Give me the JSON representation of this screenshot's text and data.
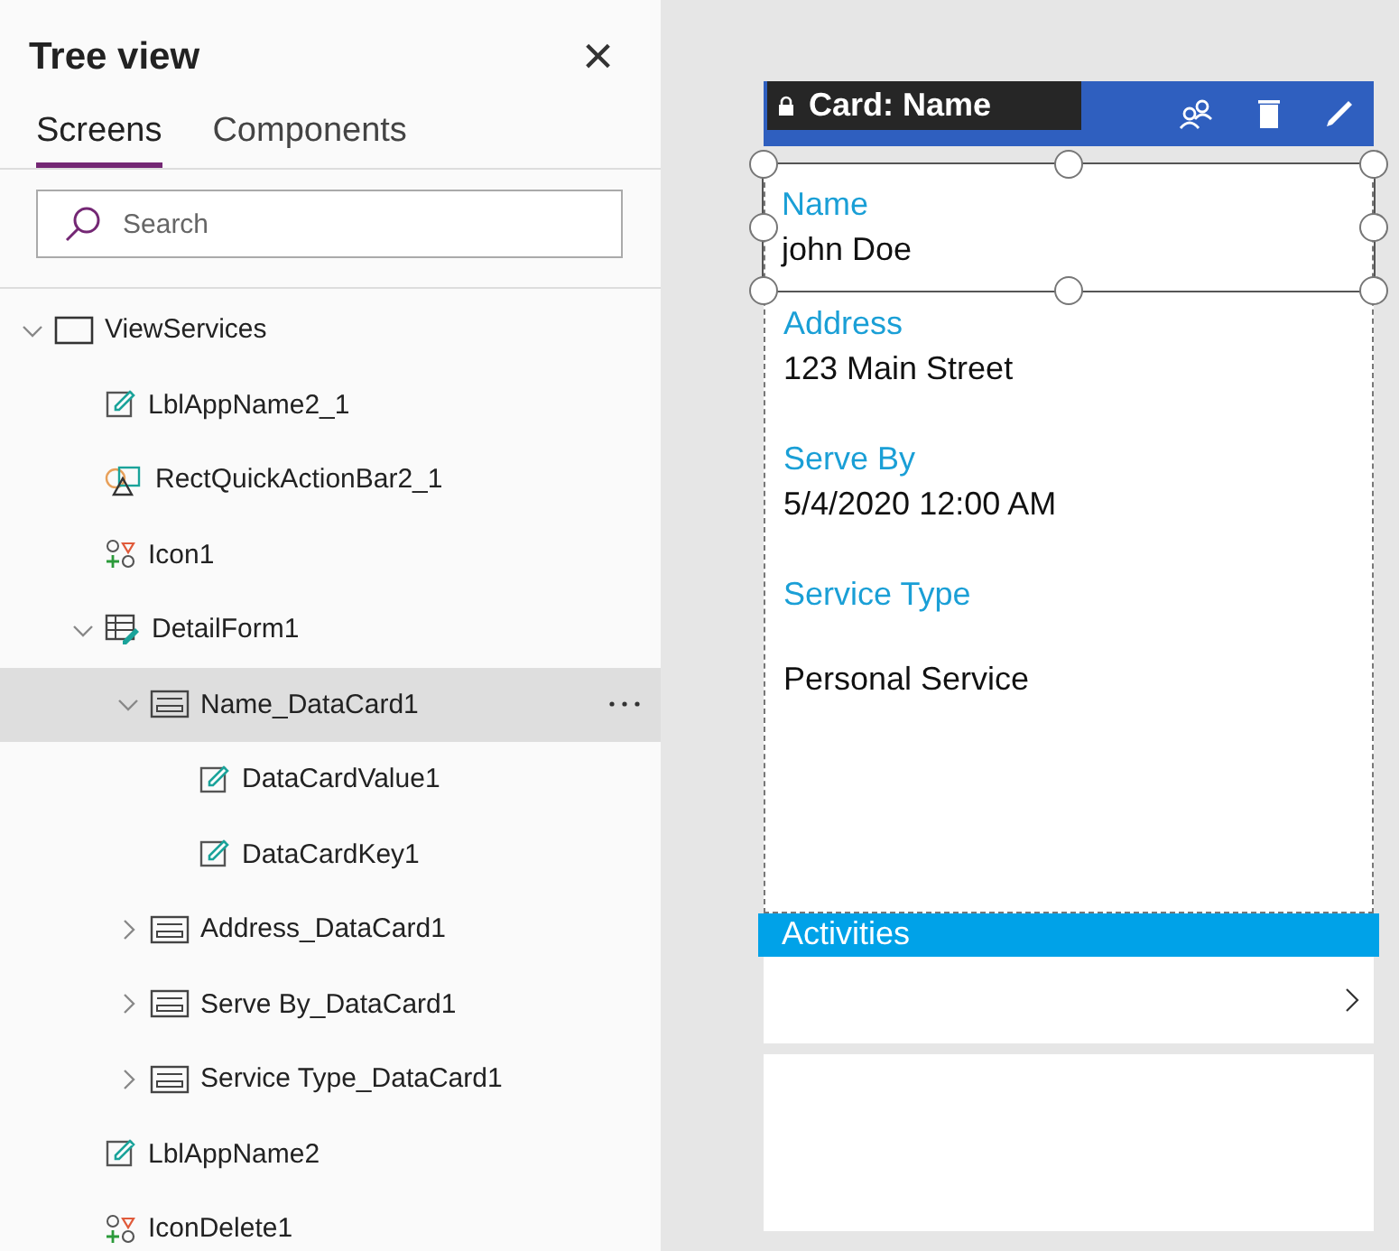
{
  "panel": {
    "title": "Tree view",
    "close": "×"
  },
  "tabs": [
    {
      "label": "Screens",
      "selected": true
    },
    {
      "label": "Components",
      "selected": false
    }
  ],
  "search": {
    "placeholder": "Search"
  },
  "tree": {
    "items": [
      {
        "label": "ViewServices",
        "kind": "screen",
        "expanded": true,
        "selected": false,
        "children": [
          {
            "label": "LblAppName2_1",
            "kind": "label",
            "selected": false
          },
          {
            "label": "RectQuickActionBar2_1",
            "kind": "shapes",
            "selected": false
          },
          {
            "label": "Icon1",
            "kind": "icons",
            "selected": false
          },
          {
            "label": "DetailForm1",
            "kind": "form",
            "expanded": true,
            "selected": false,
            "children": [
              {
                "label": "Name_DataCard1",
                "kind": "card",
                "expanded": true,
                "selected": true,
                "children": [
                  {
                    "label": "DataCardValue1",
                    "kind": "label",
                    "selected": false
                  },
                  {
                    "label": "DataCardKey1",
                    "kind": "label",
                    "selected": false
                  }
                ]
              },
              {
                "label": "Address_DataCard1",
                "kind": "card",
                "expanded": false,
                "selected": false
              },
              {
                "label": "Serve By_DataCard1",
                "kind": "card",
                "expanded": false,
                "selected": false
              },
              {
                "label": "Service Type_DataCard1",
                "kind": "card",
                "expanded": false,
                "selected": false
              }
            ]
          },
          {
            "label": "LblAppName2",
            "kind": "label",
            "selected": false
          },
          {
            "label": "IconDelete1",
            "kind": "icons",
            "selected": false
          }
        ]
      }
    ]
  },
  "canvas": {
    "tooltip": "Card: Name",
    "fields": [
      {
        "label": "Name",
        "value": "john Doe",
        "selected": true
      },
      {
        "label": "Address",
        "value": "123 Main Street",
        "selected": false
      },
      {
        "label": "Serve By",
        "value": "5/4/2020 12:00 AM",
        "selected": false
      },
      {
        "label": "Service Type",
        "value": "Personal Service",
        "selected": false
      }
    ],
    "section": {
      "title": "Activities"
    }
  }
}
